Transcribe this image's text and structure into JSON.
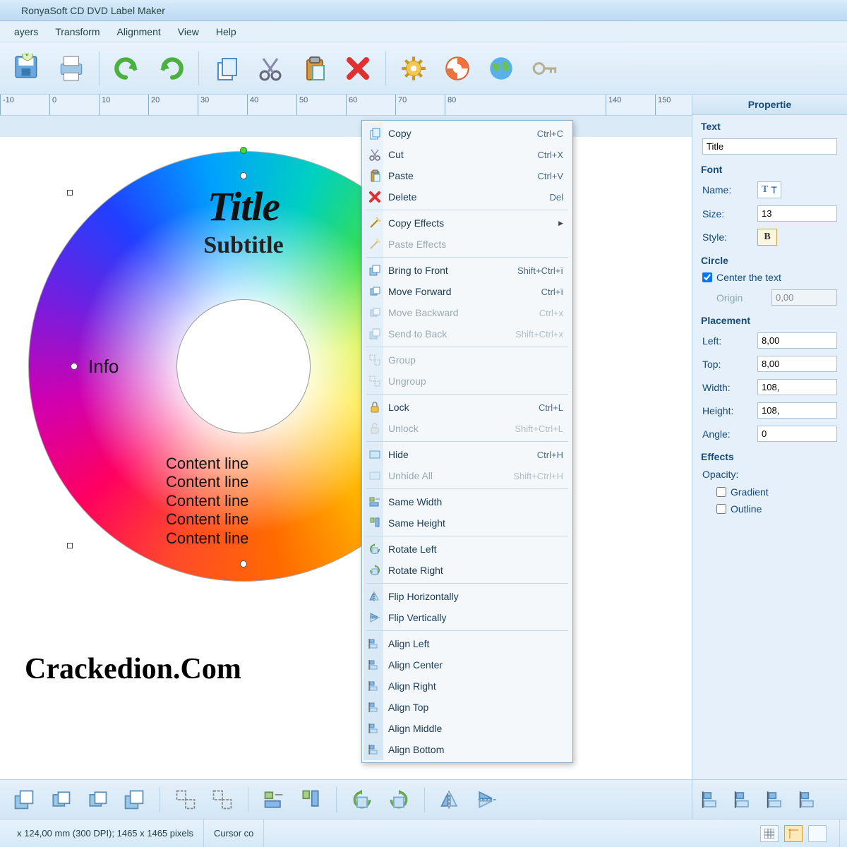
{
  "title": "RonyaSoft CD DVD Label Maker",
  "menu": [
    "ayers",
    "Transform",
    "Alignment",
    "View",
    "Help"
  ],
  "ruler_ticks": [
    -10,
    0,
    10,
    20,
    30,
    40,
    50,
    60,
    70,
    80,
    140,
    150
  ],
  "ruler_positions": [
    0,
    70,
    140,
    210,
    280,
    350,
    420,
    490,
    560,
    630,
    858,
    928
  ],
  "disc": {
    "title": "Title",
    "subtitle": "Subtitle",
    "info": "Info",
    "content": [
      "Content line",
      "Content line",
      "Content line",
      "Content line",
      "Content line"
    ]
  },
  "watermark": "Crackedion.Com",
  "context_menu": [
    {
      "icon": "copy",
      "label": "Copy",
      "shortcut": "Ctrl+C",
      "enabled": true
    },
    {
      "icon": "cut",
      "label": "Cut",
      "shortcut": "Ctrl+X",
      "enabled": true
    },
    {
      "icon": "paste",
      "label": "Paste",
      "shortcut": "Ctrl+V",
      "enabled": true
    },
    {
      "icon": "delete",
      "label": "Delete",
      "shortcut": "Del",
      "enabled": true
    },
    {
      "sep": true
    },
    {
      "icon": "copyfx",
      "label": "Copy Effects",
      "submenu": true,
      "enabled": true
    },
    {
      "icon": "pastefx",
      "label": "Paste Effects",
      "enabled": false
    },
    {
      "sep": true
    },
    {
      "icon": "front",
      "label": "Bring to Front",
      "shortcut": "Shift+Ctrl+ï",
      "enabled": true
    },
    {
      "icon": "forward",
      "label": "Move Forward",
      "shortcut": "Ctrl+ï",
      "enabled": true
    },
    {
      "icon": "backward",
      "label": "Move Backward",
      "shortcut": "Ctrl+x",
      "enabled": false
    },
    {
      "icon": "back",
      "label": "Send to Back",
      "shortcut": "Shift+Ctrl+x",
      "enabled": false
    },
    {
      "sep": true
    },
    {
      "icon": "group",
      "label": "Group",
      "enabled": false
    },
    {
      "icon": "ungroup",
      "label": "Ungroup",
      "enabled": false
    },
    {
      "sep": true
    },
    {
      "icon": "lock",
      "label": "Lock",
      "shortcut": "Ctrl+L",
      "enabled": true
    },
    {
      "icon": "unlock",
      "label": "Unlock",
      "shortcut": "Shift+Ctrl+L",
      "enabled": false
    },
    {
      "sep": true
    },
    {
      "icon": "hide",
      "label": "Hide",
      "shortcut": "Ctrl+H",
      "enabled": true
    },
    {
      "icon": "unhide",
      "label": "Unhide All",
      "shortcut": "Shift+Ctrl+H",
      "enabled": false
    },
    {
      "sep": true
    },
    {
      "icon": "samew",
      "label": "Same Width",
      "enabled": true
    },
    {
      "icon": "sameh",
      "label": "Same Height",
      "enabled": true
    },
    {
      "sep": true
    },
    {
      "icon": "rotl",
      "label": "Rotate Left",
      "enabled": true
    },
    {
      "icon": "rotr",
      "label": "Rotate Right",
      "enabled": true
    },
    {
      "sep": true
    },
    {
      "icon": "fliph",
      "label": "Flip Horizontally",
      "enabled": true
    },
    {
      "icon": "flipv",
      "label": "Flip Vertically",
      "enabled": true
    },
    {
      "sep": true
    },
    {
      "icon": "alignl",
      "label": "Align Left",
      "enabled": true
    },
    {
      "icon": "alignc",
      "label": "Align Center",
      "enabled": true
    },
    {
      "icon": "alignr",
      "label": "Align Right",
      "enabled": true
    },
    {
      "icon": "alignt",
      "label": "Align Top",
      "enabled": true
    },
    {
      "icon": "alignm",
      "label": "Align Middle",
      "enabled": true
    },
    {
      "icon": "alignb",
      "label": "Align Bottom",
      "enabled": true
    }
  ],
  "props": {
    "header": "Propertie",
    "text_section": "Text",
    "text_value": "Title",
    "font_section": "Font",
    "name_label": "Name:",
    "name_value": "T",
    "size_label": "Size:",
    "size_value": "13",
    "style_label": "Style:",
    "style_bold": "B",
    "circle_section": "Circle",
    "center_label": "Center the text",
    "origin_label": "Origin",
    "origin_value": "0,00",
    "placement_section": "Placement",
    "left_label": "Left:",
    "left_value": "8,00",
    "top_label": "Top:",
    "top_value": "8,00",
    "width_label": "Width:",
    "width_value": "108,",
    "height_label": "Height:",
    "height_value": "108,",
    "angle_label": "Angle:",
    "angle_value": "0",
    "effects_section": "Effects",
    "opacity_label": "Opacity:",
    "gradient_label": "Gradient",
    "outline_label": "Outline"
  },
  "status": {
    "dims": "x 124,00 mm (300 DPI); 1465 x 1465 pixels",
    "cursor": "Cursor co"
  }
}
